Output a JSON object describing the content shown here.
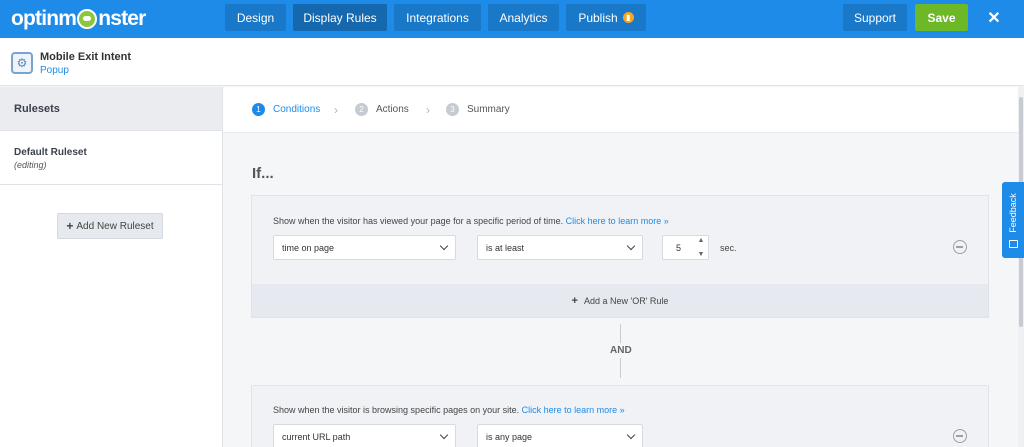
{
  "brand": {
    "logo_before": "optinm",
    "logo_after": "nster"
  },
  "nav": {
    "tabs": [
      {
        "label": "Design"
      },
      {
        "label": "Display Rules"
      },
      {
        "label": "Integrations"
      },
      {
        "label": "Analytics"
      },
      {
        "label": "Publish"
      }
    ],
    "support_label": "Support",
    "save_label": "Save",
    "close_label": "✕"
  },
  "campaign": {
    "title": "Mobile Exit Intent",
    "type": "Popup"
  },
  "sidebar": {
    "heading": "Rulesets",
    "rulesets": [
      {
        "name": "Default Ruleset",
        "status": "(editing)"
      }
    ],
    "add_label": "Add New Ruleset"
  },
  "steps": [
    {
      "number": "1",
      "label": "Conditions"
    },
    {
      "number": "2",
      "label": "Actions"
    },
    {
      "number": "3",
      "label": "Summary"
    }
  ],
  "main": {
    "if_label": "If...",
    "and_label": "AND",
    "rule1": {
      "description": "Show when the visitor has viewed your page for a specific period of time.",
      "link": "Click here to learn more »",
      "condition": "time on page",
      "operator": "is at least",
      "value": "5",
      "unit": "sec.",
      "add_or_label": "Add a New 'OR' Rule"
    },
    "rule2": {
      "description": "Show when the visitor is browsing specific pages on your site.",
      "link": "Click here to learn more »",
      "condition": "current URL path",
      "operator": "is any page"
    }
  },
  "feedback_label": "Feedback",
  "colors": {
    "primary": "#1f8be8",
    "save": "#6cb826",
    "publish_badge": "#f5a623"
  }
}
